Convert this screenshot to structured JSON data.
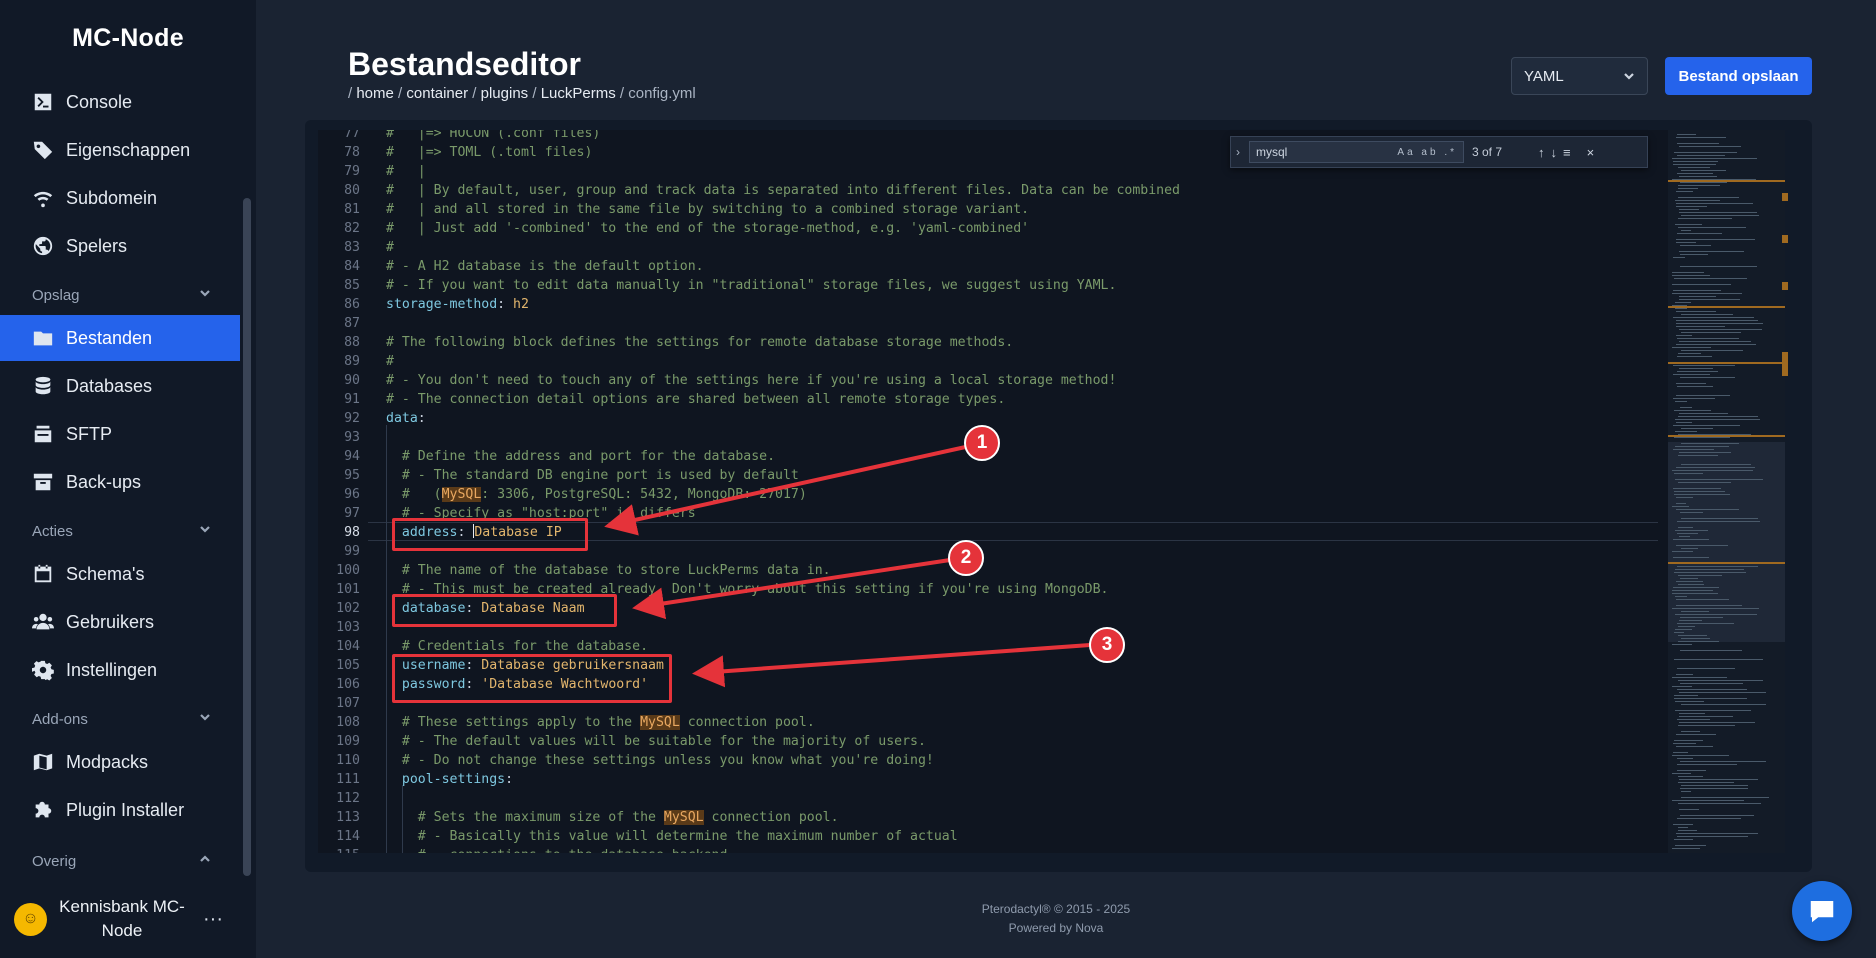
{
  "app": {
    "brand": "MC-Node"
  },
  "sidebar": {
    "items": [
      {
        "label": "Console",
        "icon": "terminal-icon"
      },
      {
        "label": "Eigenschappen",
        "icon": "tag-icon"
      },
      {
        "label": "Subdomein",
        "icon": "wifi-icon"
      },
      {
        "label": "Spelers",
        "icon": "globe-icon"
      }
    ],
    "sections": {
      "opslag": "Opslag",
      "acties": "Acties",
      "addons": "Add-ons",
      "overig": "Overig"
    },
    "storage_items": [
      {
        "label": "Bestanden",
        "icon": "folder-icon",
        "active": true
      },
      {
        "label": "Databases",
        "icon": "database-icon"
      },
      {
        "label": "SFTP",
        "icon": "server-icon"
      },
      {
        "label": "Back-ups",
        "icon": "archive-icon"
      }
    ],
    "action_items": [
      {
        "label": "Schema's",
        "icon": "calendar-icon"
      },
      {
        "label": "Gebruikers",
        "icon": "users-icon"
      },
      {
        "label": "Instellingen",
        "icon": "gear-icon"
      }
    ],
    "addon_items": [
      {
        "label": "Modpacks",
        "icon": "map-icon"
      },
      {
        "label": "Plugin Installer",
        "icon": "puzzle-icon"
      }
    ],
    "user": {
      "name_line1": "Kennisbank MC-",
      "name_line2": "Node",
      "menu": "···"
    }
  },
  "header": {
    "title": "Bestandseditor",
    "breadcrumb": {
      "sep": "/",
      "parts": [
        "home",
        "container",
        "plugins",
        "LuckPerms"
      ],
      "file": "config.yml"
    },
    "language": "YAML",
    "save_label": "Bestand opslaan"
  },
  "find": {
    "query": "mysql",
    "count": "3 of 7",
    "opts": "Aa ab .*"
  },
  "editor": {
    "current_line": "98",
    "lines": [
      {
        "n": "77",
        "t": "#   |=> HOCON (.conf files)"
      },
      {
        "n": "78",
        "t": "#   |=> TOML (.toml files)"
      },
      {
        "n": "79",
        "t": "#   |"
      },
      {
        "n": "80",
        "t": "#   | By default, user, group and track data is separated into different files. Data can be combined"
      },
      {
        "n": "81",
        "t": "#   | and all stored in the same file by switching to a combined storage variant."
      },
      {
        "n": "82",
        "t": "#   | Just add '-combined' to the end of the storage-method, e.g. 'yaml-combined'"
      },
      {
        "n": "83",
        "t": "#"
      },
      {
        "n": "84",
        "t": "# - A H2 database is the default option."
      },
      {
        "n": "85",
        "t": "# - If you want to edit data manually in \"traditional\" storage files, we suggest using YAML."
      },
      {
        "n": "86",
        "k": "storage-method",
        "v": "h2"
      },
      {
        "n": "87",
        "t": ""
      },
      {
        "n": "88",
        "t": "# The following block defines the settings for remote database storage methods."
      },
      {
        "n": "89",
        "t": "#"
      },
      {
        "n": "90",
        "t": "# - You don't need to touch any of the settings here if you're using a local storage method!"
      },
      {
        "n": "91",
        "t": "# - The connection detail options are shared between all remote storage types."
      },
      {
        "n": "92",
        "k": "data",
        "v": ""
      },
      {
        "n": "93",
        "t": ""
      },
      {
        "n": "94",
        "t": "  # Define the address and port for the database."
      },
      {
        "n": "95",
        "t": "  # - The standard DB engine port is used by default"
      },
      {
        "n": "96",
        "pre": "  #   (",
        "hl": "MySQL",
        "post": ": 3306, PostgreSQL: 5432, MongoDB: 27017)"
      },
      {
        "n": "97",
        "t": "  # - Specify as \"host:port\" if differs"
      },
      {
        "n": "98",
        "k": "  address",
        "v": "Database IP",
        "caret": true
      },
      {
        "n": "99",
        "t": ""
      },
      {
        "n": "100",
        "t": "  # The name of the database to store LuckPerms data in."
      },
      {
        "n": "101",
        "t": "  # - This must be created already. Don't worry about this setting if you're using MongoDB."
      },
      {
        "n": "102",
        "k": "  database",
        "v": "Database Naam"
      },
      {
        "n": "103",
        "t": ""
      },
      {
        "n": "104",
        "t": "  # Credentials for the database."
      },
      {
        "n": "105",
        "k": "  username",
        "v": "Database gebruikersnaam"
      },
      {
        "n": "106",
        "k": "  password",
        "v": "'Database Wachtwoord'"
      },
      {
        "n": "107",
        "t": ""
      },
      {
        "n": "108",
        "pre": "  # These settings apply to the ",
        "hl": "MySQL",
        "post": " connection pool."
      },
      {
        "n": "109",
        "t": "  # - The default values will be suitable for the majority of users."
      },
      {
        "n": "110",
        "t": "  # - Do not change these settings unless you know what you're doing!"
      },
      {
        "n": "111",
        "k": "  pool-settings",
        "v": ""
      },
      {
        "n": "112",
        "t": ""
      },
      {
        "n": "113",
        "pre": "    # Sets the maximum size of the ",
        "hl": "MySQL",
        "post": " connection pool."
      },
      {
        "n": "114",
        "t": "    # - Basically this value will determine the maximum number of actual"
      },
      {
        "n": "115",
        "t": "    #   connections to the database backend."
      }
    ]
  },
  "annotations": {
    "b1": "1",
    "b2": "2",
    "b3": "3"
  },
  "footer": {
    "line1": "Pterodactyl® © 2015 - 2025",
    "line2": "Powered by Nova"
  },
  "colors": {
    "accent": "#2563eb",
    "annotation": "#e5333a",
    "sidebar_bg": "#111927",
    "page_bg": "#1a2332"
  }
}
